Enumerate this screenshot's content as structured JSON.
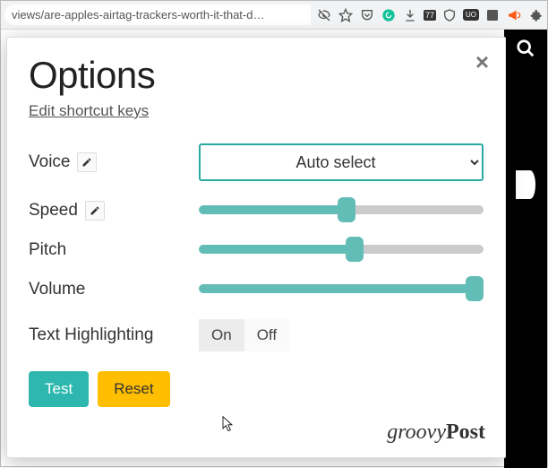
{
  "toolbar": {
    "url_fragment": "views/are-apples-airtag-trackers-worth-it-that-d…",
    "badge77": "77",
    "badgeUO": "UO"
  },
  "panel": {
    "title": "Options",
    "shortcut_link": "Edit shortcut keys",
    "labels": {
      "voice": "Voice",
      "speed": "Speed",
      "pitch": "Pitch",
      "volume": "Volume",
      "highlighting": "Text Highlighting"
    },
    "voice_selected": "Auto select",
    "sliders": {
      "speed": 52,
      "pitch": 55,
      "volume": 100
    },
    "highlight": {
      "on": "On",
      "off": "Off",
      "active": "on"
    },
    "buttons": {
      "test": "Test",
      "reset": "Reset"
    }
  },
  "brand": {
    "left": "groovy",
    "right": "Post"
  }
}
